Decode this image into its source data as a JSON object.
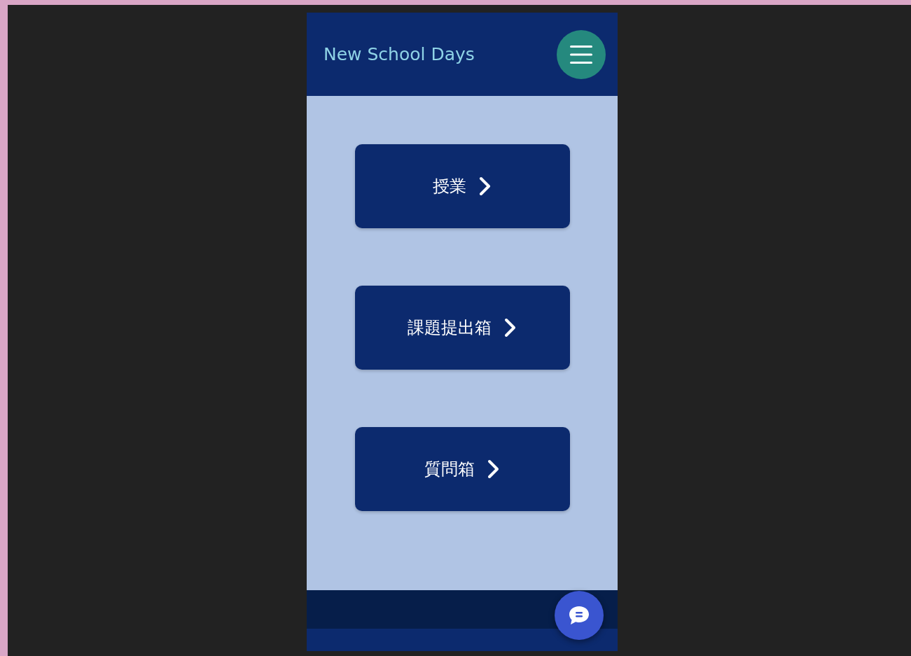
{
  "header": {
    "title": "New School Days"
  },
  "menu_buttons": [
    {
      "label": "授業"
    },
    {
      "label": "課題提出箱"
    },
    {
      "label": "質問箱"
    }
  ]
}
